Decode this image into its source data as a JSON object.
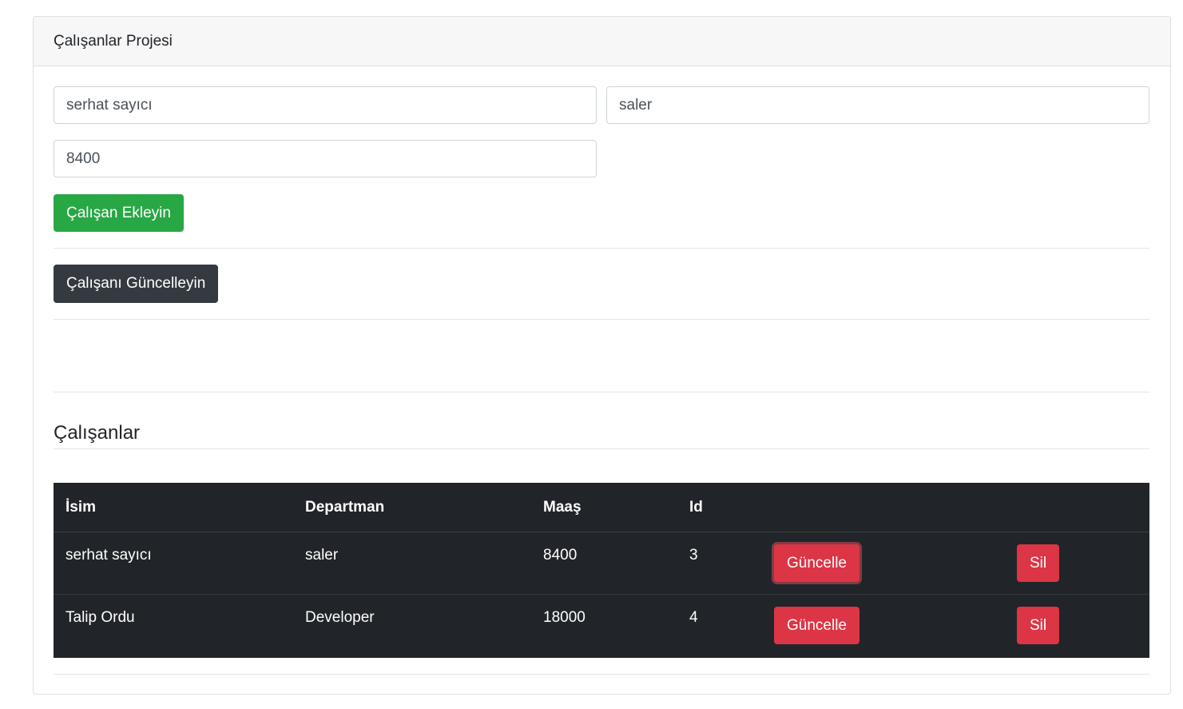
{
  "header": {
    "title": "Çalışanlar Projesi"
  },
  "form": {
    "name_value": "serhat sayıcı",
    "department_value": "saler",
    "salary_value": "8400",
    "add_button": "Çalışan Ekleyin",
    "update_button": "Çalışanı Güncelleyin"
  },
  "list": {
    "title": "Çalışanlar",
    "columns": [
      "İsim",
      "Departman",
      "Maaş",
      "Id"
    ],
    "rows": [
      {
        "name": "serhat sayıcı",
        "department": "saler",
        "salary": "8400",
        "id": "3",
        "update_label": "Güncelle",
        "delete_label": "Sil"
      },
      {
        "name": "Talip Ordu",
        "department": "Developer",
        "salary": "18000",
        "id": "4",
        "update_label": "Güncelle",
        "delete_label": "Sil"
      }
    ]
  },
  "colors": {
    "success": "#28a745",
    "dark": "#343a40",
    "danger": "#dc3545",
    "table_bg": "#212529"
  }
}
